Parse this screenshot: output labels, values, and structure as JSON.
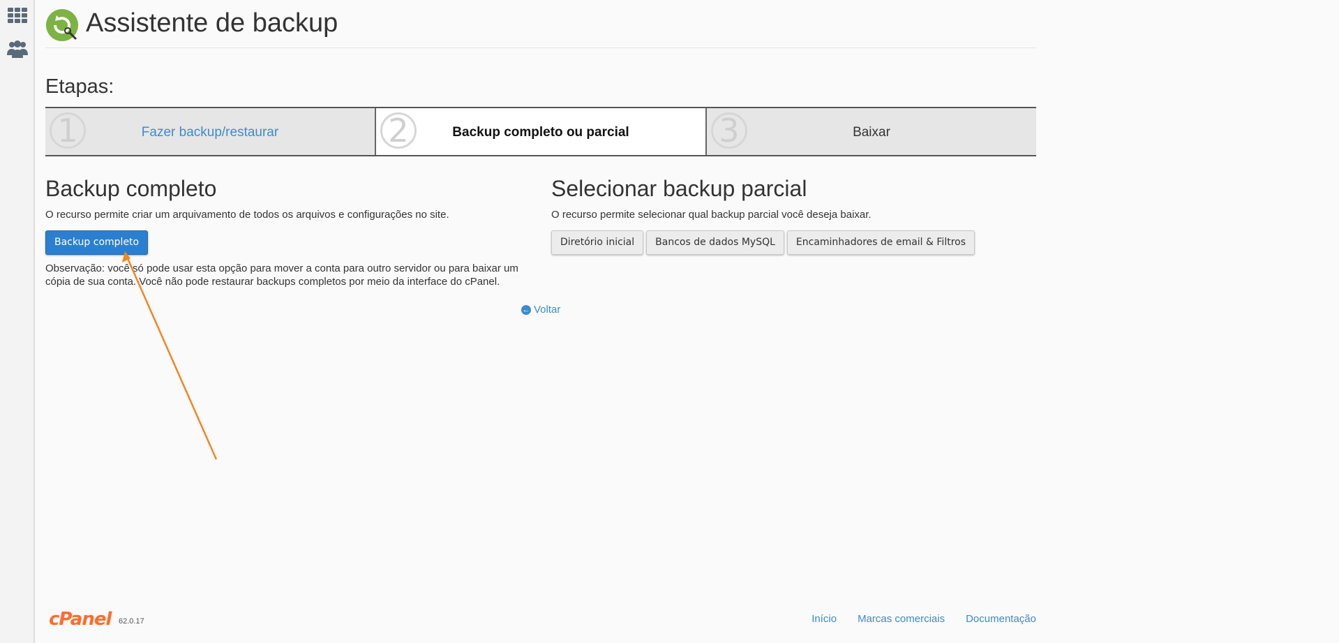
{
  "sidebar": {
    "items": [
      {
        "icon": "apps-grid-icon"
      },
      {
        "icon": "users-icon"
      }
    ]
  },
  "header": {
    "title": "Assistente de backup",
    "logo_icon": "backup-wizard-icon",
    "logo_color": "#7cb342"
  },
  "steps": {
    "label": "Etapas:",
    "items": [
      {
        "number": "1",
        "label": "Fazer backup/restaurar",
        "state": "link"
      },
      {
        "number": "2",
        "label": "Backup completo ou parcial",
        "state": "active"
      },
      {
        "number": "3",
        "label": "Baixar",
        "state": "upcoming"
      }
    ]
  },
  "full_backup": {
    "title": "Backup completo",
    "description": "O recurso permite criar um arquivamento de todos os arquivos e configurações no site.",
    "button_label": "Backup completo",
    "note": "Observação: você só pode usar esta opção para mover a conta para outro servidor ou para baixar um cópia de sua conta. Você não pode restaurar backups completos por meio da interface do cPanel."
  },
  "partial_backup": {
    "title": "Selecionar backup parcial",
    "description": "O recurso permite selecionar qual backup parcial você deseja baixar.",
    "buttons": [
      {
        "label": "Diretório inicial"
      },
      {
        "label": "Bancos de dados MySQL"
      },
      {
        "label": "Encaminhadores de email & Filtros"
      }
    ]
  },
  "back": {
    "label": "Voltar",
    "icon": "arrow-left-circle-icon"
  },
  "annotation": {
    "color": "#f5851f"
  },
  "footer": {
    "logo": "cPanel",
    "version": "62.0.17",
    "links": [
      {
        "label": "Início"
      },
      {
        "label": "Marcas comerciais"
      },
      {
        "label": "Documentação"
      }
    ]
  },
  "colors": {
    "link": "#3c8bd0",
    "primary_button": "#2b7fd1",
    "brand_orange": "#ff6c2c"
  }
}
